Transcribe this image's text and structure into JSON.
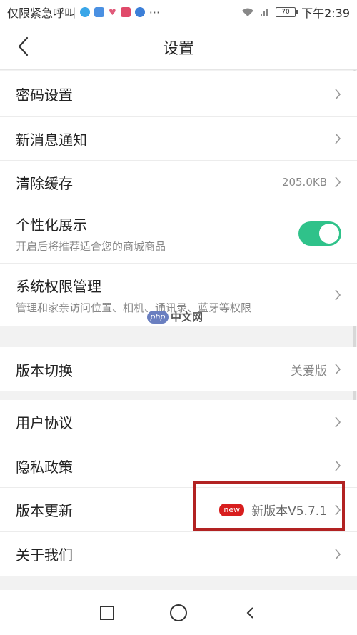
{
  "status_bar": {
    "carrier": "仅限紧急呼叫",
    "battery": "70",
    "time": "下午2:39",
    "more": "···"
  },
  "header": {
    "title": "设置"
  },
  "section1": {
    "password": {
      "label": "密码设置"
    },
    "notify": {
      "label": "新消息通知"
    },
    "cache": {
      "label": "清除缓存",
      "value": "205.0KB"
    },
    "personalize": {
      "label": "个性化展示",
      "sub": "开启后将推荐适合您的商城商品",
      "enabled": true
    },
    "permissions": {
      "label": "系统权限管理",
      "sub": "管理和家亲访问位置、相机、通讯录、蓝牙等权限"
    }
  },
  "section2": {
    "version_switch": {
      "label": "版本切换",
      "value": "关爱版"
    }
  },
  "section3": {
    "agreement": {
      "label": "用户协议"
    },
    "privacy": {
      "label": "隐私政策"
    },
    "update": {
      "label": "版本更新",
      "badge": "new",
      "value": "新版本V5.7.1"
    },
    "about": {
      "label": "关于我们"
    }
  },
  "watermark": {
    "logo": "php",
    "text": "中文网"
  },
  "colors": {
    "toggle_on": "#2fc28a",
    "badge": "#d81e1e",
    "highlight_box": "#b22222"
  }
}
